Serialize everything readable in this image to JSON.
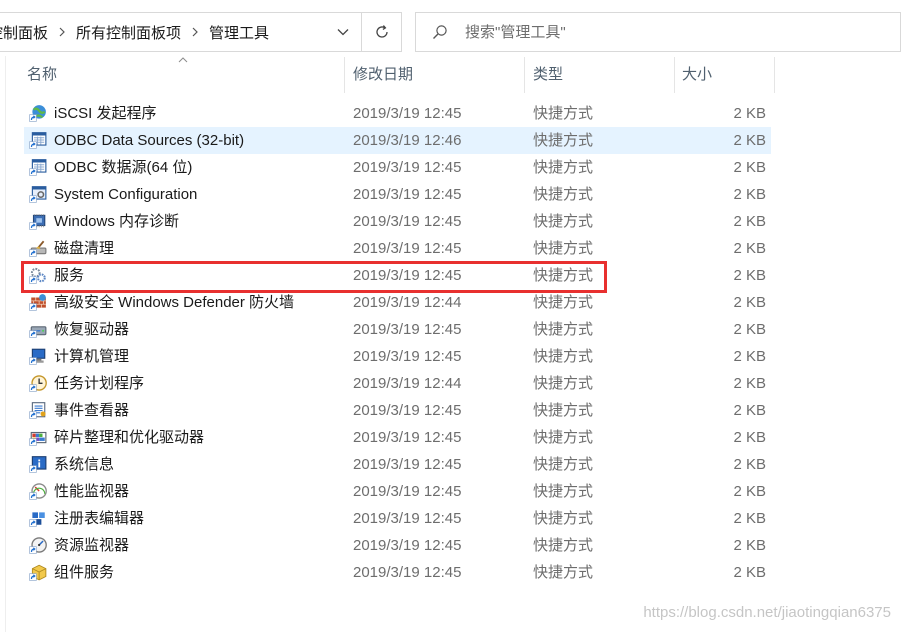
{
  "address_bar": {
    "breadcrumb": [
      "控制面板",
      "所有控制面板项",
      "管理工具"
    ],
    "separator_icon": "chevron-right-icon",
    "dropdown_icon": "chevron-down-icon"
  },
  "refresh": {
    "icon": "refresh-icon"
  },
  "search": {
    "placeholder": "搜索\"管理工具\"",
    "icon": "search-icon"
  },
  "columns": {
    "name": "名称",
    "modified": "修改日期",
    "type": "类型",
    "size": "大小",
    "sort_icon": "sort-ascending-icon"
  },
  "files": [
    {
      "name": "iSCSI 发起程序",
      "modified": "2019/3/19 12:45",
      "type": "快捷方式",
      "size": "2 KB",
      "icon": "iscsi-icon"
    },
    {
      "name": "ODBC Data Sources (32-bit)",
      "modified": "2019/3/19 12:46",
      "type": "快捷方式",
      "size": "2 KB",
      "icon": "odbc-icon"
    },
    {
      "name": "ODBC 数据源(64 位)",
      "modified": "2019/3/19 12:45",
      "type": "快捷方式",
      "size": "2 KB",
      "icon": "odbc-icon"
    },
    {
      "name": "System Configuration",
      "modified": "2019/3/19 12:45",
      "type": "快捷方式",
      "size": "2 KB",
      "icon": "system-config-icon"
    },
    {
      "name": "Windows 内存诊断",
      "modified": "2019/3/19 12:45",
      "type": "快捷方式",
      "size": "2 KB",
      "icon": "memory-diagnostic-icon"
    },
    {
      "name": "磁盘清理",
      "modified": "2019/3/19 12:45",
      "type": "快捷方式",
      "size": "2 KB",
      "icon": "disk-cleanup-icon"
    },
    {
      "name": "服务",
      "modified": "2019/3/19 12:45",
      "type": "快捷方式",
      "size": "2 KB",
      "icon": "services-icon"
    },
    {
      "name": "高级安全 Windows Defender 防火墙",
      "modified": "2019/3/19 12:44",
      "type": "快捷方式",
      "size": "2 KB",
      "icon": "firewall-icon"
    },
    {
      "name": "恢复驱动器",
      "modified": "2019/3/19 12:45",
      "type": "快捷方式",
      "size": "2 KB",
      "icon": "recovery-drive-icon"
    },
    {
      "name": "计算机管理",
      "modified": "2019/3/19 12:45",
      "type": "快捷方式",
      "size": "2 KB",
      "icon": "computer-management-icon"
    },
    {
      "name": "任务计划程序",
      "modified": "2019/3/19 12:44",
      "type": "快捷方式",
      "size": "2 KB",
      "icon": "task-scheduler-icon"
    },
    {
      "name": "事件查看器",
      "modified": "2019/3/19 12:45",
      "type": "快捷方式",
      "size": "2 KB",
      "icon": "event-viewer-icon"
    },
    {
      "name": "碎片整理和优化驱动器",
      "modified": "2019/3/19 12:45",
      "type": "快捷方式",
      "size": "2 KB",
      "icon": "defrag-icon"
    },
    {
      "name": "系统信息",
      "modified": "2019/3/19 12:45",
      "type": "快捷方式",
      "size": "2 KB",
      "icon": "system-information-icon"
    },
    {
      "name": "性能监视器",
      "modified": "2019/3/19 12:45",
      "type": "快捷方式",
      "size": "2 KB",
      "icon": "performance-monitor-icon"
    },
    {
      "name": "注册表编辑器",
      "modified": "2019/3/19 12:45",
      "type": "快捷方式",
      "size": "2 KB",
      "icon": "registry-editor-icon"
    },
    {
      "name": "资源监视器",
      "modified": "2019/3/19 12:45",
      "type": "快捷方式",
      "size": "2 KB",
      "icon": "resource-monitor-icon"
    },
    {
      "name": "组件服务",
      "modified": "2019/3/19 12:45",
      "type": "快捷方式",
      "size": "2 KB",
      "icon": "component-services-icon"
    }
  ],
  "hovered_row": 1,
  "highlighted_row": 6,
  "colors": {
    "primary_text": "#1a1a1a",
    "secondary_text": "#6d6d6d",
    "hover_background": "#e5f3ff",
    "highlight_box": "#e8302f"
  },
  "watermark": "https://blog.csdn.net/jiaotingqian6375"
}
